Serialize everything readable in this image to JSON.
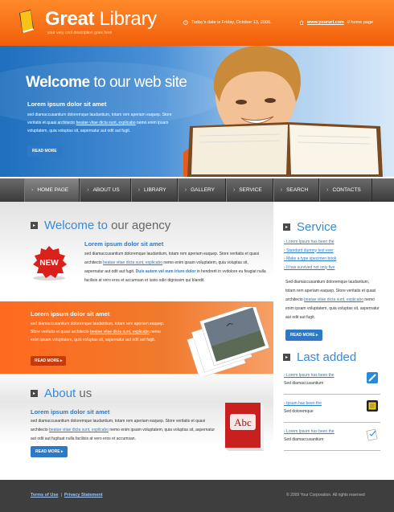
{
  "header": {
    "logo_bold": "Great",
    "logo_light": " Library",
    "tagline": "your very cool description goes here",
    "date": "Today's date is Friday, October 13, 2006.",
    "url": "www.yoururl.com",
    "home_suffix": "//  home page"
  },
  "hero": {
    "title_bold": "Welcome",
    "title_light": " to our web site",
    "subtitle": "Lorem ipsum dolor sit amet",
    "text_1": "sed diamaccusantium doloremque laudantium, totam rem aperiam eaquep. Store veritatis et quasi architecto ",
    "link": "beatae vitae dicta sunt, explicabo",
    "text_2": " nemo enim ipsam voluptatem, quia voluptas sit, aspernatur aut odit aut fugit.",
    "button": "READ MORE"
  },
  "nav": {
    "items": [
      {
        "label": "HOME PAGE"
      },
      {
        "label": "ABOUT US"
      },
      {
        "label": "LIBRARY"
      },
      {
        "label": "GALLERY"
      },
      {
        "label": "SERVICE"
      },
      {
        "label": "SEARCH"
      },
      {
        "label": "CONTACTS"
      }
    ]
  },
  "welcome": {
    "head_blue": "Welcome to",
    "head_gray": " our agency",
    "badge": "NEW",
    "subtitle": "Lorem ipsum dolor sit amet",
    "text_1": "sed diamaccusantium doloremque laudantium, totam rem aperiam eaquep. Store veritatis et quasi architecto ",
    "link": "beatae vitae dicta sunt, explicabo",
    "text_2": " nemo enim ipsam voluptatem, quia voluptas sit, aspernatur aut odit aut fugit. ",
    "bold_blue": "Duis autem vel eum iriure dolor",
    "text_3": " in hendrerit in vvdolore eu feugiat nulla facilisis at vero eros et accumsan et iusto odio dignissim qui blandit."
  },
  "promo": {
    "subtitle": "Lorem ipsum dolor sit amet",
    "text_1": "sed diamaccusantium doloremque laudantium, totam rem aperiam eaquep. Store veritatis et quasi architecto ",
    "link": "beatae vitae dicta sunt, explicabo",
    "text_2": " nemo enim ipsam voluptatem, quia voluptas sit, aspernatur aut odit aut fugit.",
    "button": "READ MORE ▸"
  },
  "about": {
    "head_blue": "About",
    "head_gray": " us",
    "subtitle": "Lorem ipsum dolor sit amet",
    "text_1": "sed diamaccusantium doloremque laudantium, totam rem aperiam eaquep. Store veritatis et quasi architecto ",
    "link": "beatae vitae dicta sunt, explicabo",
    "text_2": " nemo enim ipsam voluptatem, quia voluptas sit, aspernatur aut odit aut fugituat nulla facilisis at vero eros et accumsan.",
    "button": "READ MORE ▸",
    "book_label": "Abc"
  },
  "service": {
    "head": "Service",
    "links": [
      "Lorem Ipsum has been the",
      "Standard dummy text ever",
      "Make a type specimen book",
      "It has survived not only five"
    ],
    "text_1": "Sed diamaccusantium doloremque laudantium, totam rem aperiam eaquep. Store veritatis et quasi architecto ",
    "link": "beatae vitae dicta sunt, explicabo",
    "text_2": " nemo enim ipsam voluptatem, quia voluptas sit, aspernatur aut odit aut fugit.",
    "button": "READ MORE ▸"
  },
  "last_added": {
    "head": "Last added",
    "items": [
      {
        "link": "Lorem Ipsum has been the",
        "text": "Sed diamaccusantium",
        "icon": "pencil-icon"
      },
      {
        "link": "Ipsum has been the",
        "text": "Sed doloremque",
        "icon": "notepad-icon"
      },
      {
        "link": "Lorem Ipsum has been the",
        "text": "Sed diamaccusantium",
        "icon": "checklist-icon"
      }
    ]
  },
  "footer": {
    "terms": "Terms of Use",
    "sep": "|",
    "privacy": "Privacy Statement",
    "copyright": "© 2009 Your Corporation.  All rights reserved"
  },
  "colors": {
    "accent_orange": "#f25e0a",
    "accent_blue": "#2e79c6",
    "nav_dark": "#3a3a3a",
    "footer": "#3e3e3e"
  }
}
